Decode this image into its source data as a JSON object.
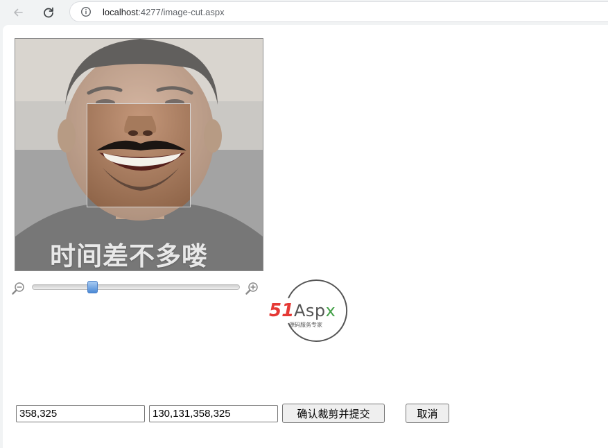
{
  "browser": {
    "url_host": "localhost",
    "url_path": ":4277/image-cut.aspx",
    "icons": {
      "back": "arrow-left-icon",
      "reload": "reload-icon",
      "info": "info-circle-icon"
    }
  },
  "cropper": {
    "caption": "时间差不多喽",
    "zoom_out_icon": "zoom-out-icon",
    "zoom_in_icon": "zoom-in-icon",
    "zoom_level": 0.28
  },
  "logo": {
    "brand_51": "51",
    "brand_aspx": "Aspx",
    "tagline": "源码服务专家",
    "colors": {
      "red": "#e53935",
      "gray": "#555555",
      "green": "#43a047"
    }
  },
  "form": {
    "size_value": "358,325",
    "rect_value": "130,131,358,325",
    "confirm_label": "确认裁剪并提交",
    "cancel_label": "取消"
  }
}
